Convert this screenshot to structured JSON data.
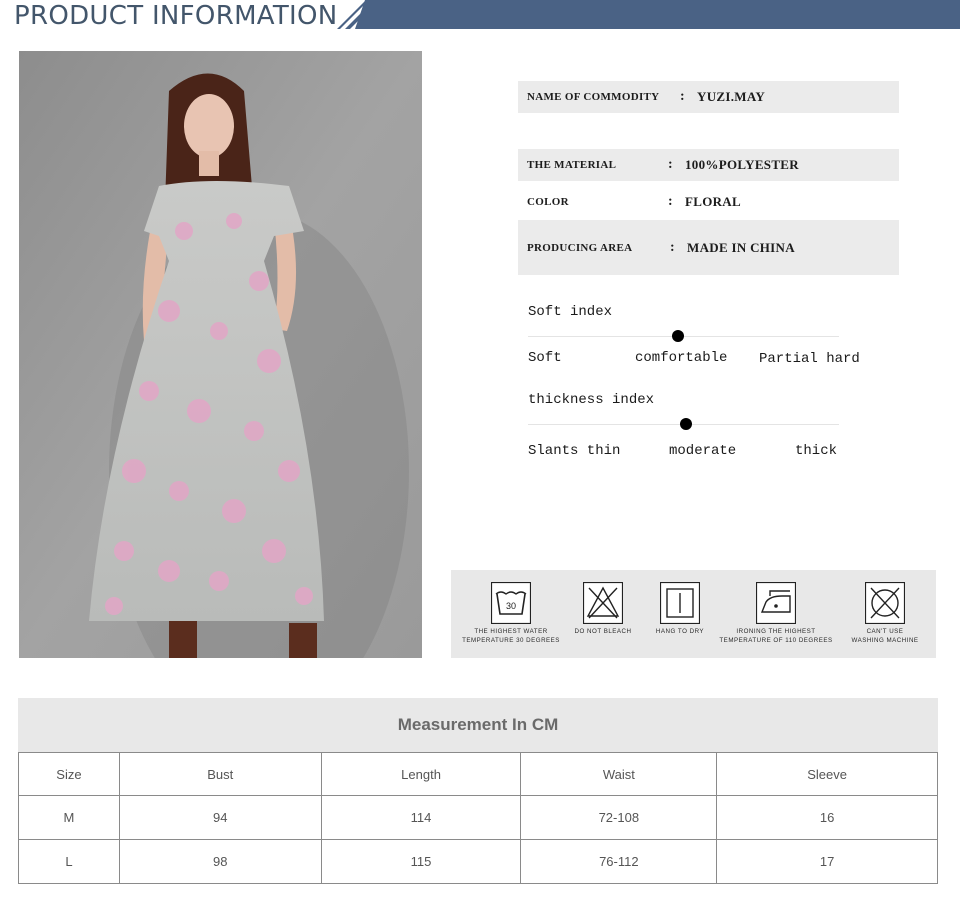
{
  "header": {
    "title": "PRODUCT INFORMATION"
  },
  "product": {
    "photo_alt": "",
    "info": [
      {
        "key": "NAME OF COMMODITY",
        "sep": ":",
        "value": "YUZI.MAY"
      },
      {
        "key": "THE MATERIAL",
        "sep": ":",
        "value": "100%POLYESTER"
      },
      {
        "key": "COLOR",
        "sep": ":",
        "value": "FLORAL"
      },
      {
        "key": "PRODUCING AREA",
        "sep": ":",
        "value": "MADE IN CHINA"
      }
    ]
  },
  "indices": {
    "soft": {
      "title": "Soft index",
      "low": "Soft",
      "mid": "comfortable",
      "high": "Partial hard",
      "level": "comfortable"
    },
    "thickness": {
      "title": "thickness index",
      "low": "Slants thin",
      "mid": "moderate",
      "high": "thick",
      "level": "moderate"
    }
  },
  "care": [
    {
      "icon": "wash-30-icon",
      "temp": "30",
      "line1": "THE HIGHEST WATER",
      "line2": "TEMPERATURE 30 DEGREES"
    },
    {
      "icon": "no-bleach-icon",
      "line1": "DO NOT BLEACH",
      "line2": ""
    },
    {
      "icon": "hang-dry-icon",
      "line1": "HANG TO DRY",
      "line2": ""
    },
    {
      "icon": "iron-low-icon",
      "line1": "IRONING THE HIGHEST",
      "line2": "TEMPERATURE OF 110 DEGREES"
    },
    {
      "icon": "no-machine-wash-icon",
      "line1": "CAN'T USE",
      "line2": "WASHING MACHINE"
    }
  ],
  "measurement": {
    "title": "Measurement In CM",
    "columns": [
      "Size",
      "Bust",
      "Length",
      "Waist",
      "Sleeve"
    ],
    "rows": [
      [
        "M",
        "94",
        "114",
        "72-108",
        "16"
      ],
      [
        "L",
        "98",
        "115",
        "76-112",
        "17"
      ]
    ]
  },
  "colors": {
    "header_band": "#4a6285",
    "panel_gray": "#ebebeb",
    "title_text": "#43566b"
  }
}
